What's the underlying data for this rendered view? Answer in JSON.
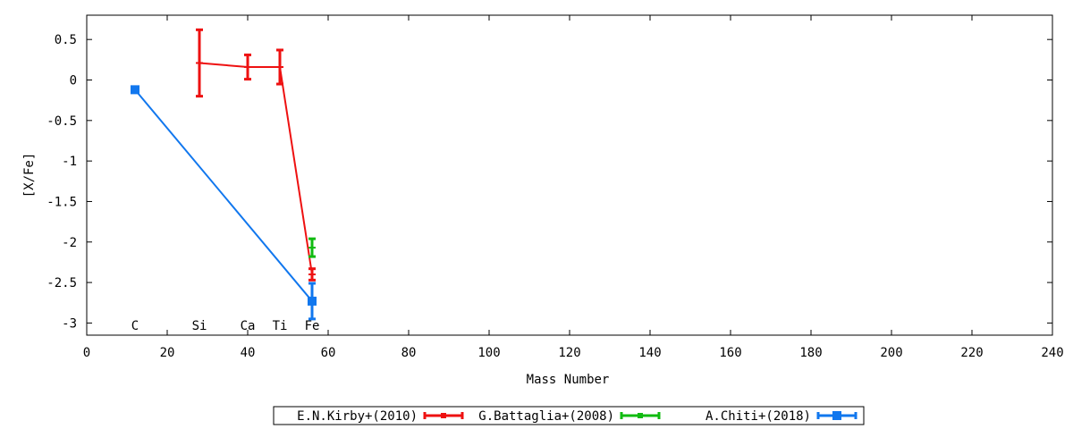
{
  "chart_data": {
    "type": "scatter",
    "xlabel": "Mass Number",
    "ylabel": "[X/Fe]",
    "xlim": [
      0,
      240
    ],
    "ylim": [
      -3.15,
      0.8
    ],
    "x_ticks": [
      0,
      20,
      40,
      60,
      80,
      100,
      120,
      140,
      160,
      180,
      200,
      220,
      240
    ],
    "y_ticks": [
      0.5,
      0,
      -0.5,
      -1,
      -1.5,
      -2,
      -2.5,
      -3
    ],
    "y_tick_labels": [
      "0.5",
      "0",
      "-0.5",
      "-1",
      "-1.5",
      "-2",
      "-2.5",
      "-3"
    ],
    "grid": false,
    "legend_position": "bottom",
    "element_labels": [
      {
        "text": "C",
        "x": 12
      },
      {
        "text": "Si",
        "x": 28
      },
      {
        "text": "Ca",
        "x": 40
      },
      {
        "text": "Ti",
        "x": 48
      },
      {
        "text": "Fe",
        "x": 56
      }
    ],
    "element_label_y": -3.03,
    "series": [
      {
        "name": "E.N.Kirby+(2010)",
        "color": "#ee1111",
        "marker": "cross",
        "points": [
          {
            "x": 28,
            "y": 0.21,
            "err": 0.41
          },
          {
            "x": 40,
            "y": 0.16,
            "err": 0.15
          },
          {
            "x": 48,
            "y": 0.16,
            "err": 0.21
          },
          {
            "x": 56,
            "y": -2.4,
            "err": 0.07
          }
        ]
      },
      {
        "name": "G.Battaglia+(2008)",
        "color": "#11bb11",
        "marker": "cross",
        "points": [
          {
            "x": 56,
            "y": -2.07,
            "err": 0.11
          }
        ]
      },
      {
        "name": "A.Chiti+(2018)",
        "color": "#1177ee",
        "marker": "square",
        "points": [
          {
            "x": 12,
            "y": -0.12,
            "err": 0
          },
          {
            "x": 56,
            "y": -2.73,
            "err": 0.22
          }
        ]
      }
    ]
  }
}
